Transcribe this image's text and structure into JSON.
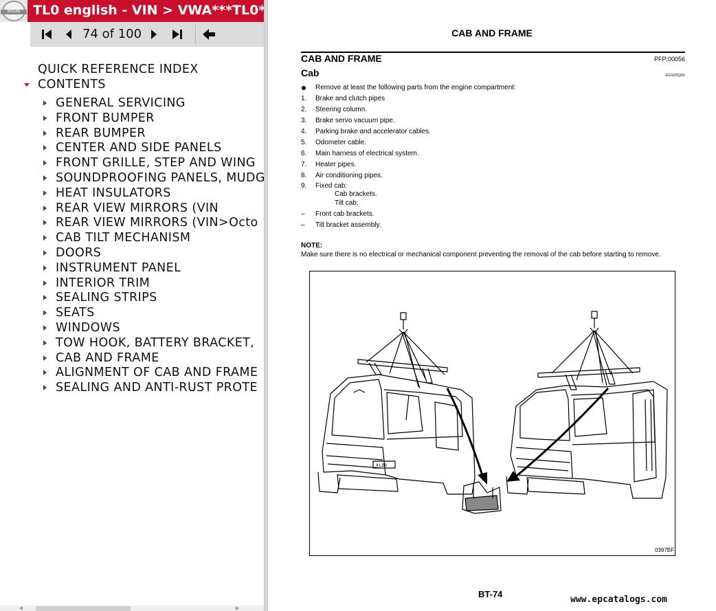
{
  "window": {
    "title": "TL0 english - VIN > VWA***TL0*",
    "logo_text": "NISSAN"
  },
  "navigation": {
    "first_icon": "first-page-icon",
    "prev_icon": "previous-page-icon",
    "page_label": "74 of 100",
    "next_icon": "next-page-icon",
    "last_icon": "last-page-icon",
    "back_icon": "back-arrow-icon"
  },
  "toc": {
    "top_items": [
      {
        "label": "QUICK REFERENCE INDEX",
        "expanded": null
      },
      {
        "label": "CONTENTS",
        "expanded": true
      }
    ],
    "items": [
      "GENERAL SERVICING",
      "FRONT BUMPER",
      "REAR BUMPER",
      "CENTER AND SIDE PANELS",
      "FRONT GRILLE, STEP AND WING",
      "SOUNDPROOFING PANELS, MUDG",
      "HEAT INSULATORS",
      "REAR VIEW MIRRORS (VIN",
      "REAR VIEW MIRRORS (VIN>Octo",
      "CAB TILT MECHANISM",
      "DOORS",
      "INSTRUMENT PANEL",
      "INTERIOR TRIM",
      "SEALING STRIPS",
      "SEATS",
      "WINDOWS",
      "TOW HOOK, BATTERY BRACKET,",
      "CAB AND FRAME",
      "ALIGNMENT OF CAB AND FRAME",
      "SEALING AND ANTI-RUST PROTE"
    ]
  },
  "document": {
    "header": "CAB AND FRAME",
    "section_title": "CAB AND FRAME",
    "section_code": "PFP:00056",
    "subsection_title": "Cab",
    "subsection_code": "EGS00Q01",
    "steps": [
      {
        "marker": "●",
        "text": "Remove at least the following parts from the engine compartment:"
      },
      {
        "marker": "1.",
        "text": "Brake and clutch pipes"
      },
      {
        "marker": "2.",
        "text": "Steering column."
      },
      {
        "marker": "3.",
        "text": "Brake servo vacuum pipe."
      },
      {
        "marker": "4.",
        "text": "Parking brake and accelerator cables."
      },
      {
        "marker": "5.",
        "text": "Odometer cable."
      },
      {
        "marker": "6.",
        "text": "Main harness of electrical system."
      },
      {
        "marker": "7.",
        "text": "Heater pipes."
      },
      {
        "marker": "8.",
        "text": "Air conditioning pipes."
      },
      {
        "marker": "9.",
        "text": "Fixed cab:"
      }
    ],
    "fixed_cab_sub": "Cab brackets.",
    "tilt_cab_label": "Tilt cab:",
    "dash_steps": [
      {
        "marker": "–",
        "text": "Front cab brackets."
      },
      {
        "marker": "–",
        "text": "Tilt bracket assembly."
      }
    ],
    "note_label": "NOTE:",
    "note_text": "Make sure there is no electrical or mechanical component preventing the removal of the cab before starting to remove.",
    "figure_code": "0397BF",
    "figure_badge": "4 LBS",
    "page_number": "BT-74",
    "watermark": "www.epcatalogs.com"
  },
  "colors": {
    "title_bar": "#c8102e",
    "nav_bar": "#dcdcdc",
    "expand_marker": "#c8102e",
    "text": "#111111"
  }
}
